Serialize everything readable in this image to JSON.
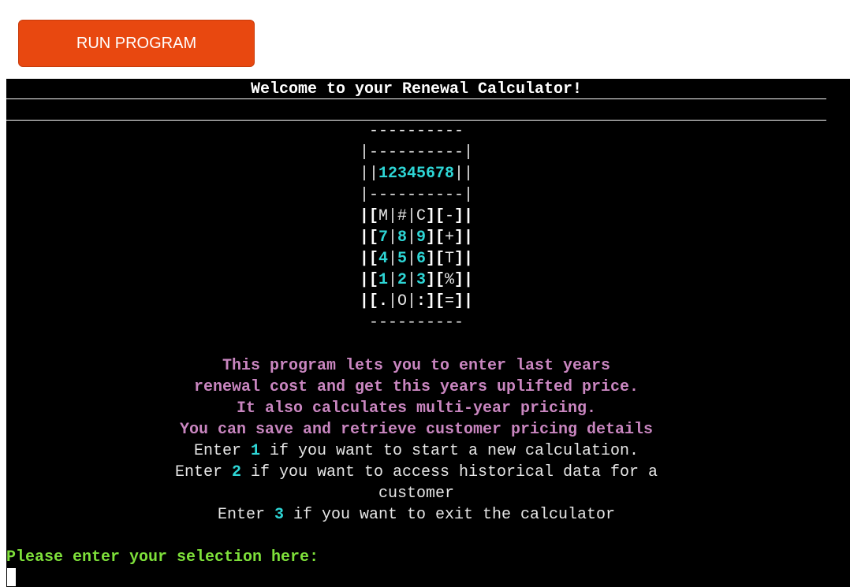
{
  "run_button": {
    "label": "RUN PROGRAM"
  },
  "terminal": {
    "title": "Welcome to your Renewal Calculator!",
    "art": {
      "top": "----------",
      "frame": "|----------|",
      "display_open": "||",
      "display_digits": "12345678",
      "display_close": "||",
      "row_m": {
        "pre": "|[",
        "m": "M",
        "s1": "|",
        "hash": "#",
        "s2": "|",
        "c": "C",
        "mid": "][",
        "op": "-",
        "post": "]|"
      },
      "row_789": {
        "pre": "|[",
        "d1": "7",
        "s1": "|",
        "d2": "8",
        "s2": "|",
        "d3": "9",
        "mid": "][",
        "op": "+",
        "post": "]|"
      },
      "row_456": {
        "pre": "|[",
        "d1": "4",
        "s1": "|",
        "d2": "5",
        "s2": "|",
        "d3": "6",
        "mid": "][",
        "op": "T",
        "post": "]|"
      },
      "row_123": {
        "pre": "|[",
        "d1": "1",
        "s1": "|",
        "d2": "2",
        "s2": "|",
        "d3": "3",
        "mid": "][",
        "op": "%",
        "post": "]|"
      },
      "row_dot": {
        "pre": "|[",
        "dot": ".",
        "s1": "|",
        "o": "O",
        "s2": "|",
        "colon": ":",
        "mid": "][",
        "op": "=",
        "post": "]|"
      },
      "bottom": "----------"
    },
    "description": [
      "This program lets you to enter last years",
      "renewal cost and get this years uplifted price.",
      "It also calculates multi-year pricing.",
      "You can save and retrieve customer pricing details"
    ],
    "options": [
      {
        "pre": "Enter ",
        "num": "1",
        "post": " if you want to start a new calculation."
      },
      {
        "pre": "Enter ",
        "num": "2",
        "post": " if you want to access historical data for a"
      },
      {
        "pre": "",
        "num": "",
        "post": "customer"
      },
      {
        "pre": "Enter ",
        "num": "3",
        "post": " if you want to exit the calculator"
      }
    ],
    "prompt": "Please enter your selection here:"
  }
}
